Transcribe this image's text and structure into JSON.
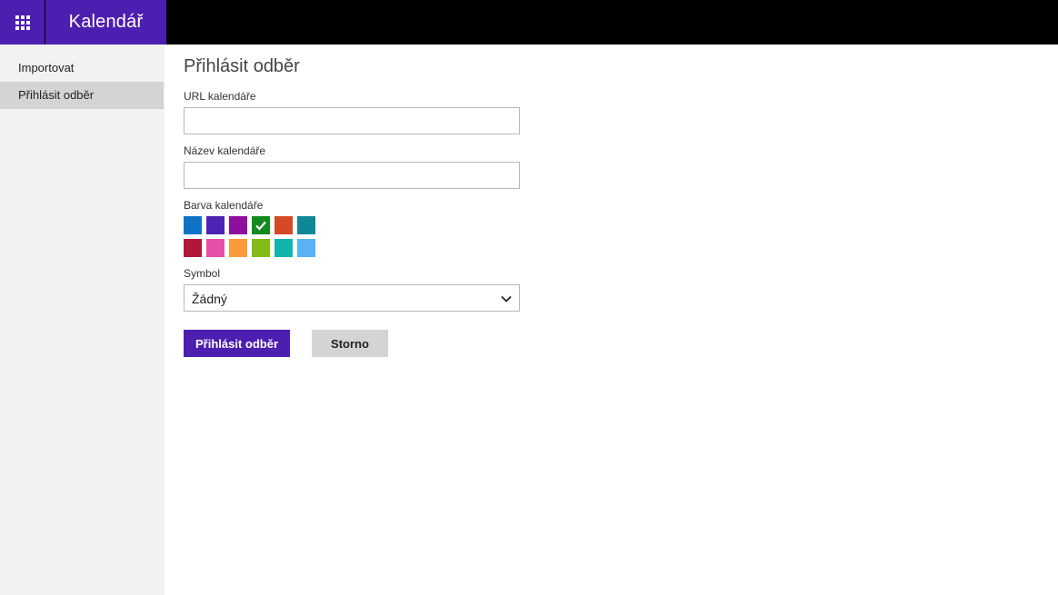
{
  "header": {
    "app_title": "Kalendář",
    "waffle_icon": "app-launcher-icon",
    "accent_color": "#4d1fb0",
    "bar_color": "#000000"
  },
  "sidebar": {
    "items": [
      {
        "label": "Importovat",
        "selected": false
      },
      {
        "label": "Přihlásit odběr",
        "selected": true
      }
    ]
  },
  "form": {
    "title": "Přihlásit odběr",
    "url_label": "URL kalendáře",
    "url_value": "",
    "name_label": "Název kalendáře",
    "name_value": "",
    "color_label": "Barva kalendáře",
    "colors": [
      "#0f72c5",
      "#4b24b3",
      "#8e0f9e",
      "#138a1f",
      "#d44a27",
      "#0f8896",
      "#b0173a",
      "#e44fa8",
      "#fb9a3a",
      "#84bb14",
      "#11b4ad",
      "#59b1f6"
    ],
    "selected_color": "#138a1f",
    "symbol_label": "Symbol",
    "symbol_value": "Žádný",
    "subscribe_label": "Přihlásit odběr",
    "cancel_label": "Storno"
  }
}
